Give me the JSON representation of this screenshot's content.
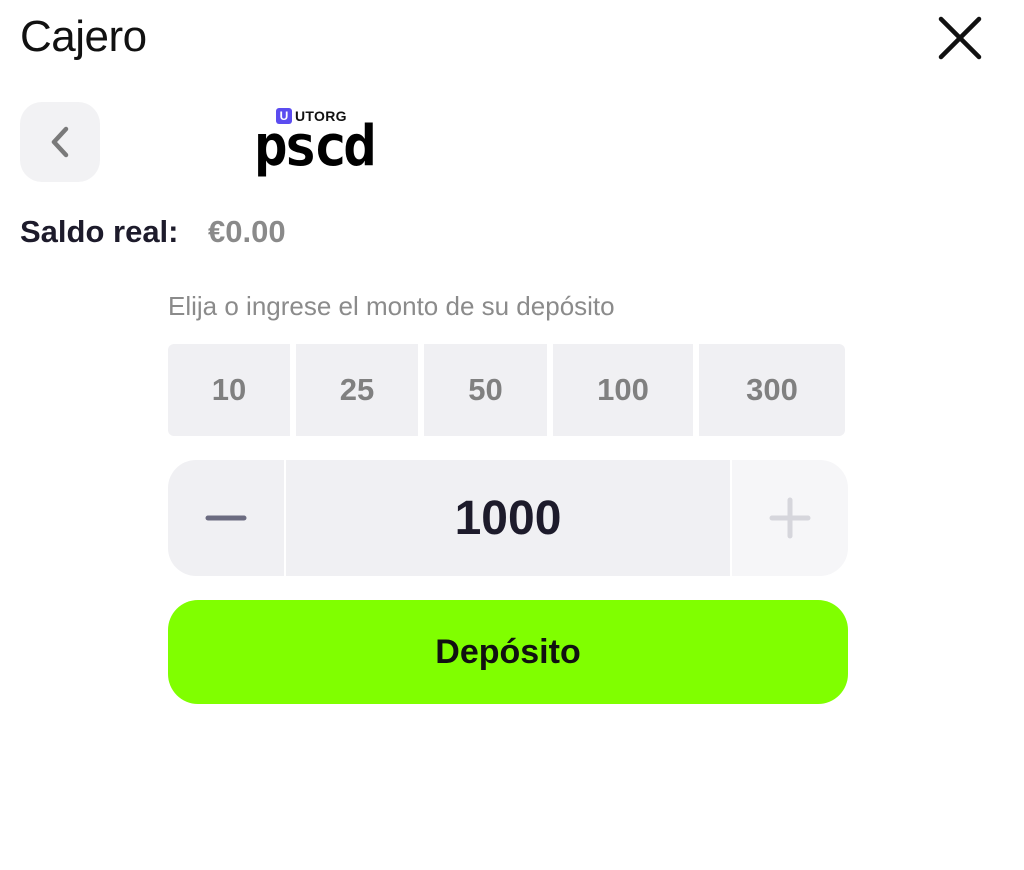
{
  "header": {
    "title": "Cajero",
    "close_icon": "close-icon"
  },
  "nav": {
    "back_icon": "chevron-left-icon"
  },
  "provider": {
    "badge_letter": "U",
    "brand": "UTORG",
    "name": "pscd",
    "badge_color": "#5b4cf0"
  },
  "balance": {
    "label": "Saldo real:",
    "value": "€0.00"
  },
  "deposit": {
    "hint": "Elija o ingrese el monto de su depósito",
    "presets": [
      "10",
      "25",
      "50",
      "100",
      "300"
    ],
    "amount": "1000",
    "minus_icon": "minus-icon",
    "plus_icon": "plus-icon",
    "button_label": "Depósito",
    "button_color": "#80ff00"
  }
}
